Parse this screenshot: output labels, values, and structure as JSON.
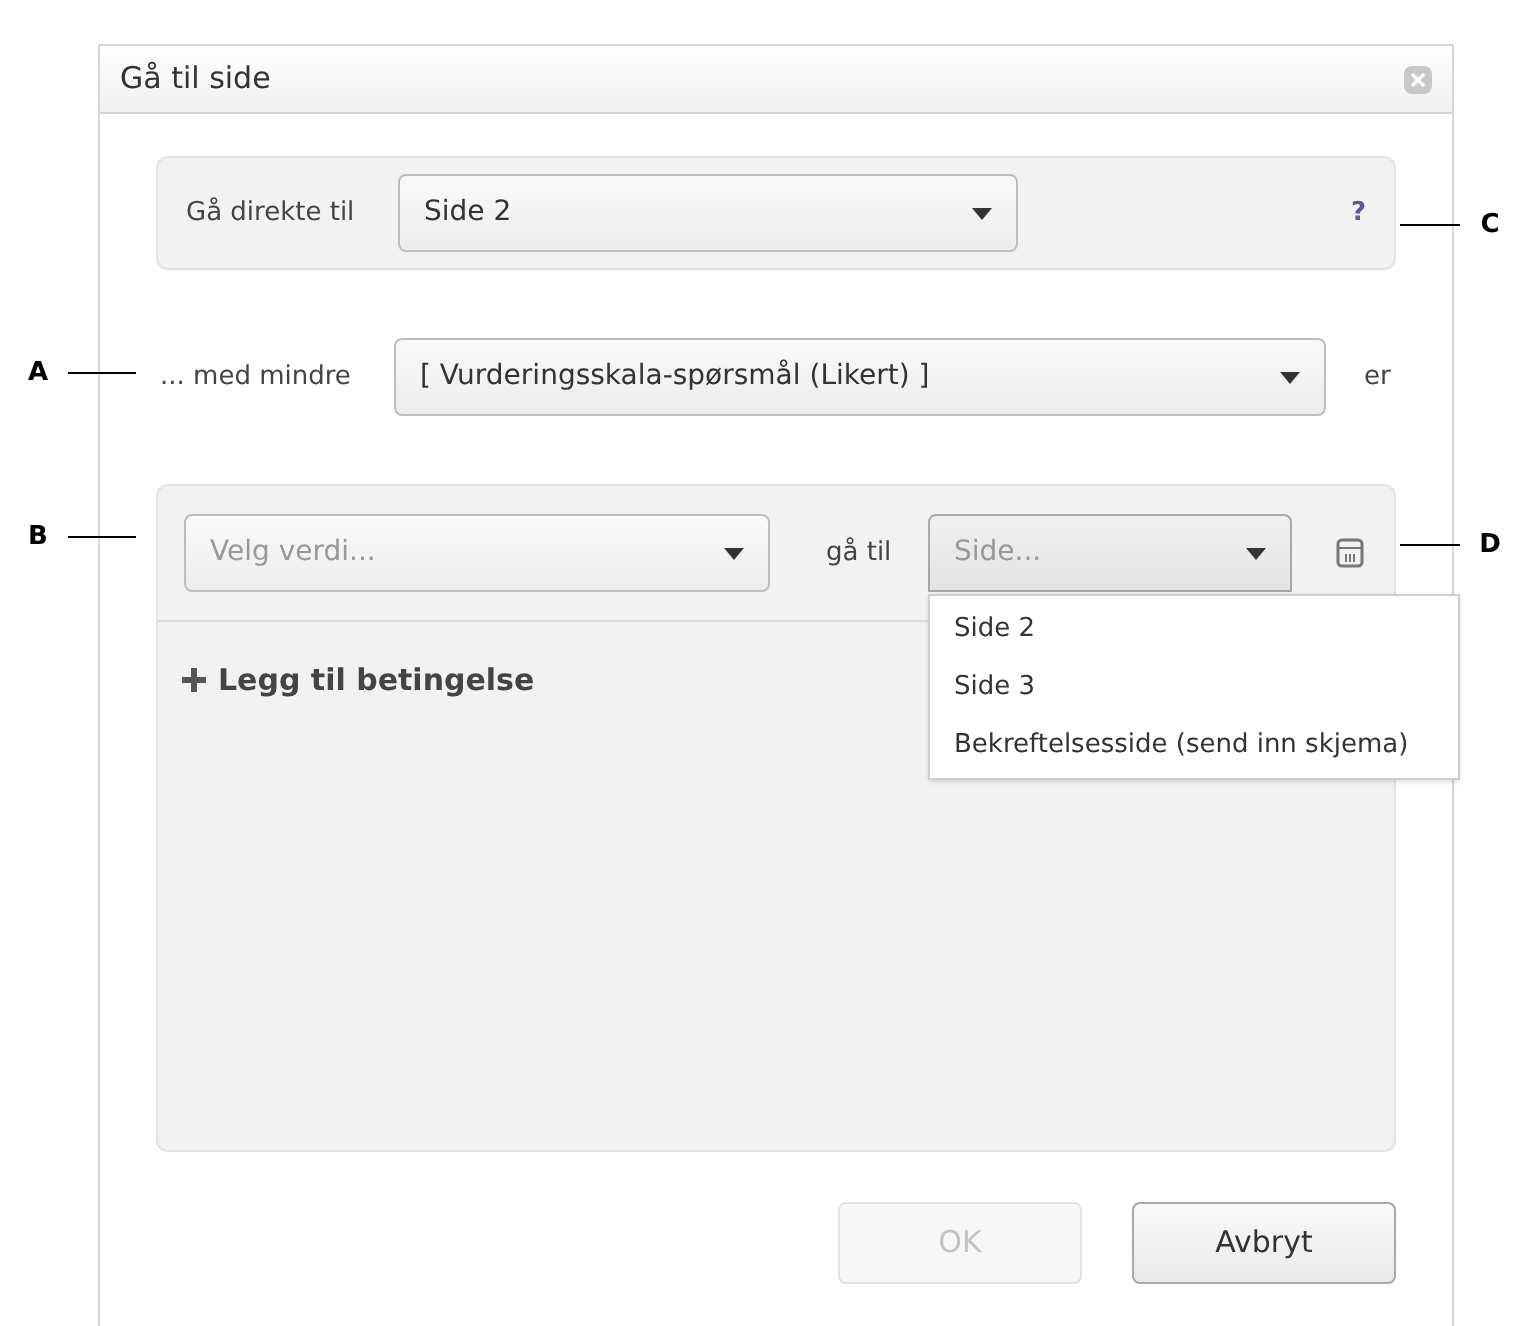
{
  "dialog": {
    "title": "Gå til side"
  },
  "direct": {
    "label": "Gå direkte til",
    "value": "Side 2",
    "help": "?"
  },
  "condition": {
    "prefix": "... med mindre",
    "value": "[ Vurderingsskala-spørsmål (Likert) ]",
    "suffix": "er"
  },
  "rule": {
    "value_placeholder": "Velg verdi...",
    "goto_label": "gå til",
    "page_placeholder": "Side...",
    "expanded": true,
    "options": [
      "Side 2",
      "Side 3",
      "Bekreftelsesside (send inn skjema)"
    ],
    "add_condition": "Legg til betingelse"
  },
  "buttons": [
    {
      "label": "OK",
      "disabled": true
    },
    {
      "label": "Avbryt",
      "disabled": false
    }
  ],
  "callouts": [
    {
      "letter": "A"
    },
    {
      "letter": "B"
    },
    {
      "letter": "C"
    },
    {
      "letter": "D"
    }
  ]
}
